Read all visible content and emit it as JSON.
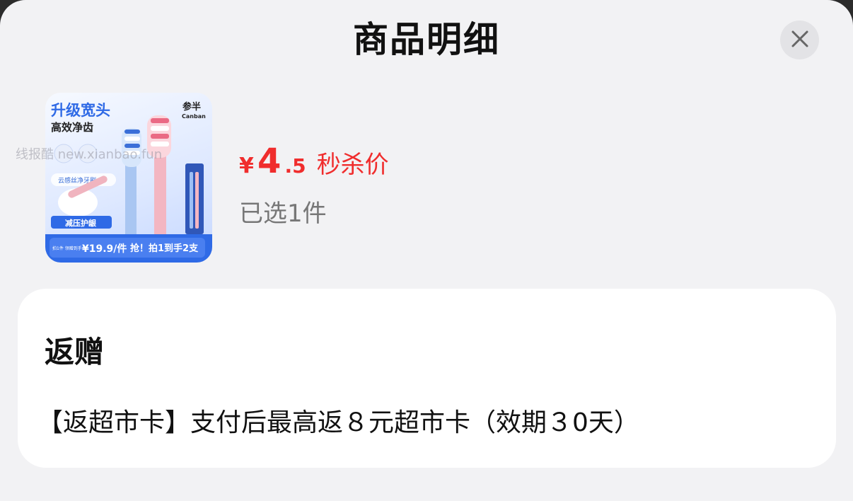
{
  "header": {
    "title": "商品明细",
    "close_icon": "close-icon"
  },
  "product": {
    "image": {
      "headline": "升级宽头",
      "subline": "高效净齿",
      "brand_cn": "参半",
      "brand_en": "Canban",
      "badge": "减压护龈",
      "promo_small": "拍1件 领赠到手价",
      "promo_price": "¥19.9/件",
      "promo_action": "抢！拍1到手2支",
      "chip_text": "云感丝净牙刷"
    },
    "price": {
      "currency": "¥",
      "integer": "4",
      "decimal": ".5",
      "label": "秒杀价",
      "color": "#f02d2d"
    },
    "quantity_text": "已选1件"
  },
  "watermark": "线报酷 new.xianbao.fun",
  "rebate": {
    "title": "返赠",
    "description": "【返超市卡】支付后最高返８元超市卡（效期３0天）"
  }
}
